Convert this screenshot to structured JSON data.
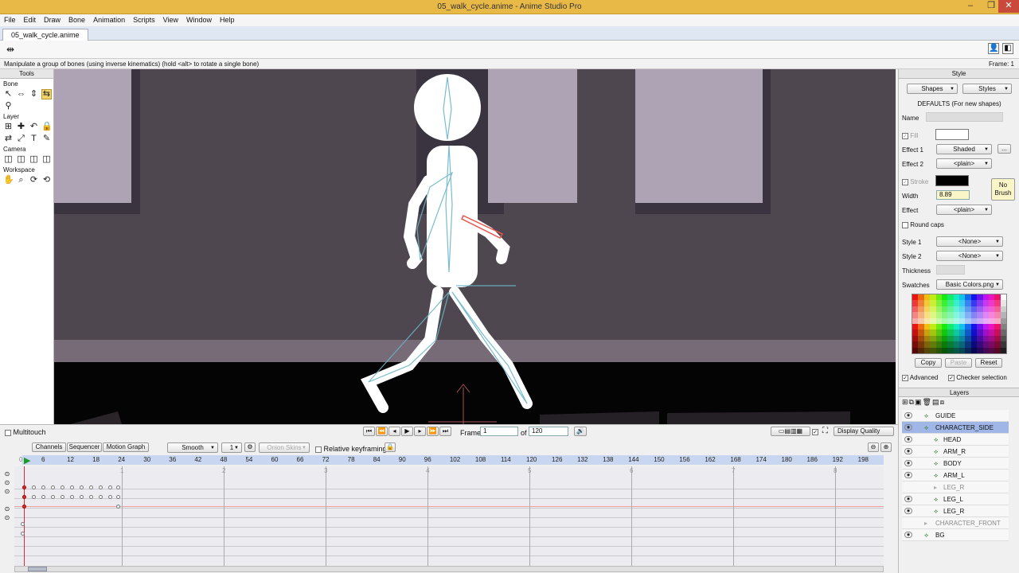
{
  "window": {
    "title": "05_walk_cycle.anime - Anime Studio Pro"
  },
  "menu": [
    "File",
    "Edit",
    "Draw",
    "Bone",
    "Animation",
    "Scripts",
    "View",
    "Window",
    "Help"
  ],
  "doc_tab": "05_walk_cycle.anime",
  "status": {
    "message": "Manipulate a group of bones (using inverse kinematics) (hold <alt> to rotate a single bone)",
    "frame": "Frame: 1"
  },
  "tools": {
    "header": "Tools",
    "sections": {
      "bone": "Bone",
      "layer": "Layer",
      "camera": "Camera",
      "workspace": "Workspace"
    }
  },
  "playback": {
    "frame_label": "Frame",
    "frame_value": "1",
    "of_label": "of",
    "total_frames": "120",
    "display_quality": "Display Quality"
  },
  "timeline": {
    "tabs": [
      "Channels",
      "Sequencer",
      "Motion Graph"
    ],
    "interp": "Smooth",
    "interp_count": "1",
    "onion": "Onion Skins",
    "relative_kf": "Relative keyframing",
    "ruler": [
      "0",
      "6",
      "12",
      "18",
      "24",
      "30",
      "36",
      "42",
      "48",
      "54",
      "60",
      "66",
      "72",
      "78",
      "84",
      "90",
      "96",
      "102",
      "108",
      "114",
      "120",
      "126",
      "132",
      "138",
      "144",
      "150",
      "156",
      "162",
      "168",
      "174",
      "180",
      "186",
      "192",
      "198"
    ],
    "markers": [
      "1",
      "2",
      "3",
      "4",
      "5",
      "6",
      "7",
      "8"
    ]
  },
  "style_panel": {
    "header": "Style",
    "shapes_btn": "Shapes",
    "styles_btn": "Styles",
    "defaults": "DEFAULTS (For new shapes)",
    "name_label": "Name",
    "fill_label": "Fill",
    "effect1_label": "Effect 1",
    "effect1_value": "Shaded",
    "more": "...",
    "effect2_label": "Effect 2",
    "effect2_value": "<plain>",
    "stroke_label": "Stroke",
    "width_label": "Width",
    "width_value": "8.89",
    "no_brush": "No Brush",
    "effect_label": "Effect",
    "effect_value": "<plain>",
    "round_caps": "Round caps",
    "style1_label": "Style 1",
    "style1_value": "<None>",
    "style2_label": "Style 2",
    "style2_value": "<None>",
    "thickness_label": "Thickness",
    "swatches_label": "Swatches",
    "swatches_value": "Basic Colors.png",
    "copy": "Copy",
    "paste": "Paste",
    "reset": "Reset",
    "advanced": "Advanced",
    "checker": "Checker selection",
    "colors": {
      "stroke": "#000000",
      "fill": "#ffffff"
    }
  },
  "layers": {
    "header": "Layers",
    "items": [
      {
        "name": "GUIDE",
        "indent": 1
      },
      {
        "name": "CHARACTER_SIDE",
        "indent": 1,
        "selected": true
      },
      {
        "name": "HEAD",
        "indent": 2
      },
      {
        "name": "ARM_R",
        "indent": 2
      },
      {
        "name": "BODY",
        "indent": 2
      },
      {
        "name": "ARM_L",
        "indent": 2
      },
      {
        "name": "LEG_R",
        "indent": 2,
        "hidden": true
      },
      {
        "name": "LEG_L",
        "indent": 2
      },
      {
        "name": "LEG_R",
        "indent": 2
      },
      {
        "name": "CHARACTER_FRONT",
        "indent": 1,
        "hidden": true
      },
      {
        "name": "BG",
        "indent": 1
      }
    ]
  }
}
